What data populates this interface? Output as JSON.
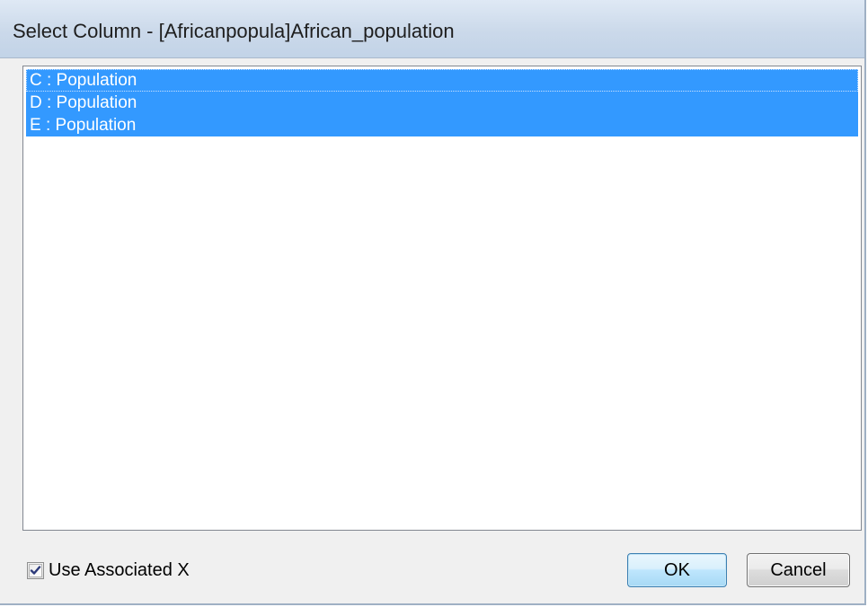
{
  "window": {
    "title": "Select Column - [Africanpopula]African_population"
  },
  "columns": {
    "items": [
      {
        "label": "C : Population",
        "selected": true
      },
      {
        "label": "D : Population",
        "selected": true
      },
      {
        "label": "E : Population",
        "selected": true
      }
    ]
  },
  "options": {
    "use_associated_x_label": "Use Associated X",
    "use_associated_x_checked": true
  },
  "buttons": {
    "ok_label": "OK",
    "cancel_label": "Cancel"
  },
  "colors": {
    "selection": "#3399ff",
    "titlebar": "#cbd9ea"
  }
}
